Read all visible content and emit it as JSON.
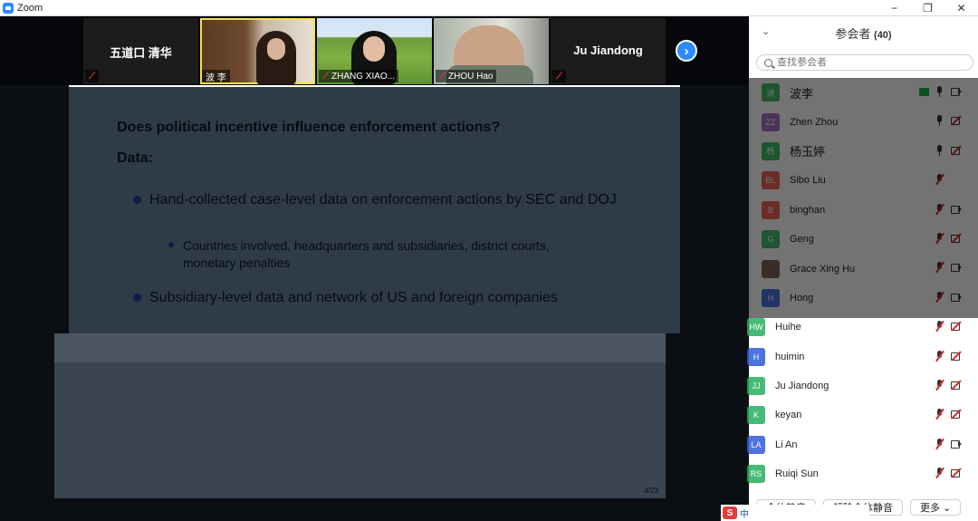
{
  "window": {
    "title": "Zoom",
    "minimize": "−",
    "maximize": "❐",
    "close": "✕"
  },
  "video_tiles": [
    {
      "name": "五道口 清华",
      "label": "",
      "type": "dark",
      "muted": true
    },
    {
      "name": "",
      "label": "波 李",
      "type": "p1",
      "muted": false
    },
    {
      "name": "",
      "label": "ZHANG XIAO...",
      "type": "p2",
      "muted": true
    },
    {
      "name": "",
      "label": "ZHOU Hao",
      "type": "p3",
      "muted": true
    },
    {
      "name": "Ju Jiandong",
      "label": "",
      "type": "dark",
      "muted": true
    }
  ],
  "next_page": "›",
  "slide": {
    "question": "Does political incentive influence enforcement actions?",
    "data_heading": "Data:",
    "bullet1": "Hand-collected case-level data on enforcement actions by SEC and DOJ",
    "subbullet1": "Countries involved, headquarters and subsidiaries, district courts, monetary penalties",
    "bullet2": "Subsidiary-level data and network of US and foreign companies",
    "page": "4/23"
  },
  "panel": {
    "collapse": "⌄",
    "title": "参会者",
    "count": "(40)",
    "search_placeholder": "查找参会者",
    "participants": [
      {
        "initials": "波",
        "name": "波李",
        "color": "#23b14d",
        "mic": "on",
        "cam": "on",
        "sharing": true,
        "big": true
      },
      {
        "initials": "ZZ",
        "name": "Zhen Zhou",
        "color": "#9b59b6",
        "mic": "on",
        "cam": "off",
        "sharing": false,
        "big": false
      },
      {
        "initials": "杨",
        "name": "杨玉婷",
        "color": "#23b14d",
        "mic": "on",
        "cam": "off",
        "sharing": false,
        "big": true
      },
      {
        "initials": "BL",
        "name": "Sibo Liu",
        "color": "#e74c3c",
        "mic": "muted",
        "cam": "none",
        "sharing": false,
        "big": false
      },
      {
        "initials": "B",
        "name": "binghan",
        "color": "#e74c3c",
        "mic": "muted",
        "cam": "on",
        "sharing": false,
        "big": false
      },
      {
        "initials": "G",
        "name": "Geng",
        "color": "#27ae60",
        "mic": "muted",
        "cam": "off",
        "sharing": false,
        "big": false
      },
      {
        "initials": "",
        "name": "Grace Xing Hu",
        "color": "#6b4a3a",
        "mic": "muted",
        "cam": "on",
        "sharing": false,
        "big": false
      },
      {
        "initials": "H",
        "name": "Hong",
        "color": "#2f5bd8",
        "mic": "muted",
        "cam": "on",
        "sharing": false,
        "big": false
      },
      {
        "initials": "HW",
        "name": "Huihe",
        "color": "#27ae60",
        "mic": "muted",
        "cam": "off",
        "sharing": false,
        "big": false
      },
      {
        "initials": "H",
        "name": "huimin",
        "color": "#2f5bd8",
        "mic": "muted",
        "cam": "off",
        "sharing": false,
        "big": false
      },
      {
        "initials": "JJ",
        "name": "Ju Jiandong",
        "color": "#27ae60",
        "mic": "muted",
        "cam": "off",
        "sharing": false,
        "big": false
      },
      {
        "initials": "K",
        "name": "keyan",
        "color": "#27ae60",
        "mic": "muted",
        "cam": "off",
        "sharing": false,
        "big": false
      },
      {
        "initials": "LA",
        "name": "Li An",
        "color": "#2f5bd8",
        "mic": "muted",
        "cam": "on",
        "sharing": false,
        "big": false
      },
      {
        "initials": "RS",
        "name": "Ruiqi Sun",
        "color": "#27ae60",
        "mic": "muted",
        "cam": "off",
        "sharing": false,
        "big": false
      }
    ],
    "mute_all": "全体静音",
    "unmute_all": "解除全体静音",
    "more": "更多 ⌄"
  },
  "taskbar": {
    "ime": "S",
    "lang": "中"
  }
}
